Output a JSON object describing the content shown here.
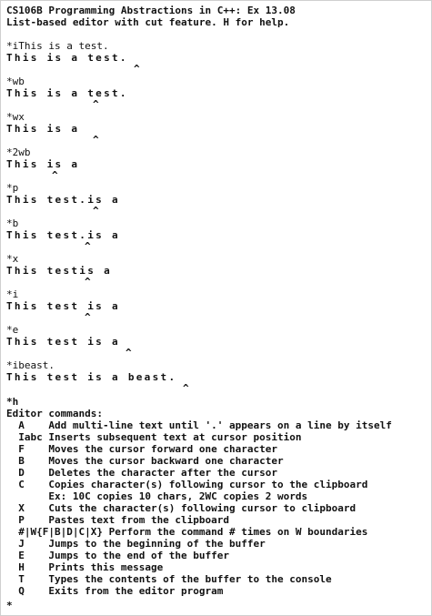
{
  "header": {
    "title": "CS106B Programming Abstractions in C++: Ex 13.08",
    "subtitle": "List-based editor with cut feature. H for help."
  },
  "session": [
    {
      "cmd": "*iThis is a test.",
      "buffer": "This is a test.",
      "cursor": 15
    },
    {
      "cmd": "*wb",
      "buffer": "This is a test.",
      "cursor": 10
    },
    {
      "cmd": "*wx",
      "buffer": "This is a",
      "cursor": 10
    },
    {
      "cmd": "*2wb",
      "buffer": "This is a",
      "cursor": 5
    },
    {
      "cmd": "*p",
      "buffer": "This test.is a",
      "cursor": 10
    },
    {
      "cmd": "*b",
      "buffer": "This test.is a",
      "cursor": 9
    },
    {
      "cmd": "*x",
      "buffer": "This testis a",
      "cursor": 9
    },
    {
      "cmd": "*i",
      "buffer": "This test is a",
      "cursor": 9
    },
    {
      "cmd": "*e",
      "buffer": "This test is a",
      "cursor": 14
    },
    {
      "cmd": "*ibeast.",
      "buffer": "This test is a beast.",
      "cursor": 21
    }
  ],
  "help": {
    "cmd": "*h",
    "heading": "Editor commands:",
    "commands": [
      "  A    Add multi-line text until '.' appears on a line by itself",
      "  Iabc Inserts subsequent text at cursor position",
      "  F    Moves the cursor forward one character",
      "  B    Moves the cursor backward one character",
      "  D    Deletes the character after the cursor",
      "  C    Copies character(s) following cursor to the clipboard",
      "       Ex: 10C copies 10 chars, 2WC copies 2 words",
      "  X    Cuts the character(s) following cursor to clipboard",
      "  P    Pastes text from the clipboard",
      "  #|W{F|B|D|C|X} Perform the command # times on W boundaries",
      "  J    Jumps to the beginning of the buffer",
      "  E    Jumps to the end of the buffer",
      "  H    Prints this message",
      "  T    Types the contents of the buffer to the console",
      "  Q    Exits from the editor program"
    ],
    "prompt": "*"
  }
}
